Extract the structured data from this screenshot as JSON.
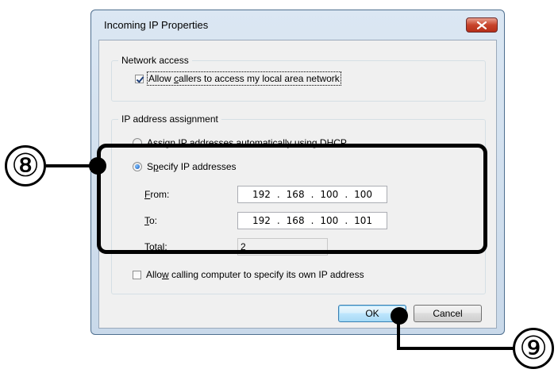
{
  "dialog": {
    "title": "Incoming IP Properties",
    "close_icon": "close-icon"
  },
  "network_access": {
    "legend": "Network access",
    "allow_callers": {
      "pre": "Allow ",
      "key": "c",
      "post": "allers to access my local area network",
      "checked": true
    }
  },
  "ip_assignment": {
    "legend": "IP address assignment",
    "dhcp_radio": {
      "pre": "",
      "key": "A",
      "post": "ssign IP addresses automatically using DHCP",
      "selected": false
    },
    "specify_radio": {
      "pre": "S",
      "key": "p",
      "post": "ecify IP addresses",
      "selected": true
    },
    "from": {
      "key": "F",
      "post": "rom:",
      "octets": [
        "192",
        "168",
        "100",
        "100"
      ],
      "sep": "."
    },
    "to": {
      "key": "T",
      "post": "o:",
      "octets": [
        "192",
        "168",
        "100",
        "101"
      ],
      "sep": "."
    },
    "total": {
      "label": "Total:",
      "value": "2"
    },
    "allow_specify": {
      "pre": "Allo",
      "key": "w",
      "post": " calling computer to specify its own IP address",
      "checked": false
    }
  },
  "buttons": {
    "ok": "OK",
    "cancel": "Cancel"
  },
  "callouts": {
    "eight": "⑧",
    "nine": "⑨"
  }
}
